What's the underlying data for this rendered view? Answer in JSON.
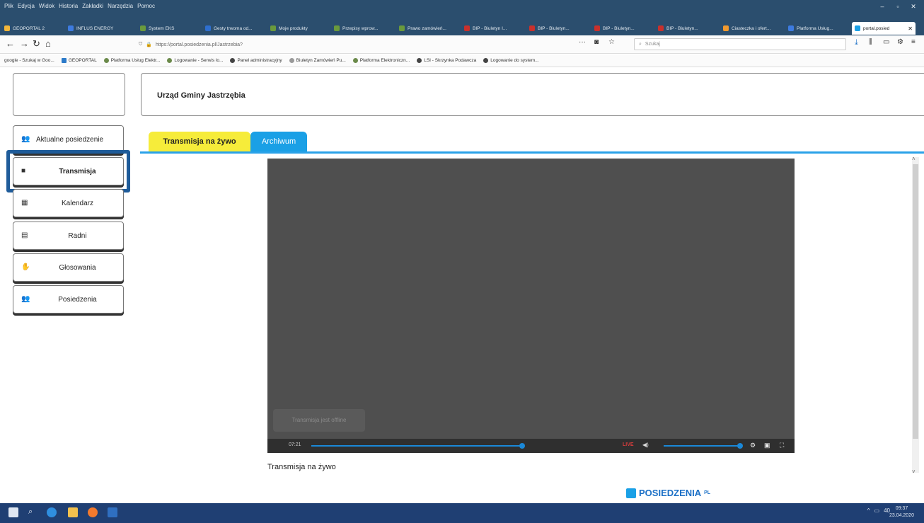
{
  "browser": {
    "menu": [
      "Plik",
      "Edycja",
      "Widok",
      "Historia",
      "Zakładki",
      "Narzędzia",
      "Pomoc"
    ],
    "tabs": [
      {
        "label": "GEOPORTAL 2",
        "color": "#f2b63a"
      },
      {
        "label": "INFLUS ENERGY",
        "color": "#3d7be0"
      },
      {
        "label": "System EKS",
        "color": "#6a9a3c"
      },
      {
        "label": "Gesty trwoma od...",
        "color": "#2e6fcf"
      },
      {
        "label": "Moje produkty",
        "color": "#6a9a3c"
      },
      {
        "label": "Przepisy wprow...",
        "color": "#6a9a3c"
      },
      {
        "label": "Prawo zamówień...",
        "color": "#6a9a3c"
      },
      {
        "label": "BIP - Biuletyn I...",
        "color": "#c9302c"
      },
      {
        "label": "BIP - Biuletyn...",
        "color": "#c9302c"
      },
      {
        "label": "BIP - Biuletyn...",
        "color": "#c9302c"
      },
      {
        "label": "BIP - Biuletyn...",
        "color": "#c9302c"
      },
      {
        "label": "Ciasteczka i ofert...",
        "color": "#f29a2e"
      },
      {
        "label": "Platforma Usług...",
        "color": "#3d7be0"
      },
      {
        "label": "portal.posied",
        "color": "#1aa0e6"
      }
    ],
    "url": "https://portal.posiedzenia.pl/Jastrzebia?",
    "url_domain": "posiedzenia.pl",
    "search_placeholder": "Szukaj",
    "bookmarks": [
      "google - Szukaj w Goo...",
      "GEOPORTAL",
      "Platforma Usług Elektr...",
      "Logowanie - Serwis lo...",
      "Panel administracyjny",
      "Biuletyn Zamówień Pu...",
      "Platforma Elektroniczn...",
      "LSI - Skrzynka Podawcza",
      "Logowanie do system..."
    ]
  },
  "header": {
    "title": "Urząd Gminy Jastrzębia"
  },
  "sidebar": {
    "items": [
      {
        "label": "Aktualne posiedzenie",
        "icon": "users-icon"
      },
      {
        "label": "Transmisja",
        "icon": "camera-icon"
      },
      {
        "label": "Kalendarz",
        "icon": "calendar-icon"
      },
      {
        "label": "Radni",
        "icon": "id-card-icon"
      },
      {
        "label": "Głosowania",
        "icon": "hand-icon"
      },
      {
        "label": "Posiedzenia",
        "icon": "users-icon"
      }
    ]
  },
  "content_tabs": {
    "live": "Transmisja na żywo",
    "archive": "Archiwum"
  },
  "player": {
    "offline_text": "Transmisja jest offline",
    "time": "07:21",
    "live_label": "LIVE"
  },
  "caption": "Transmisja na żywo",
  "footer": {
    "logo": "POSIEDZENIA",
    "logo_suffix": "PL"
  },
  "taskbar": {
    "time": "09:37",
    "date": "23.04.2020",
    "tray_text": "40"
  },
  "colors": {
    "live_tab": "#f6ec3a",
    "archive_tab": "#1aa0e6",
    "highlight": "#1f5c9a",
    "titlebar": "#2b4e6e"
  }
}
